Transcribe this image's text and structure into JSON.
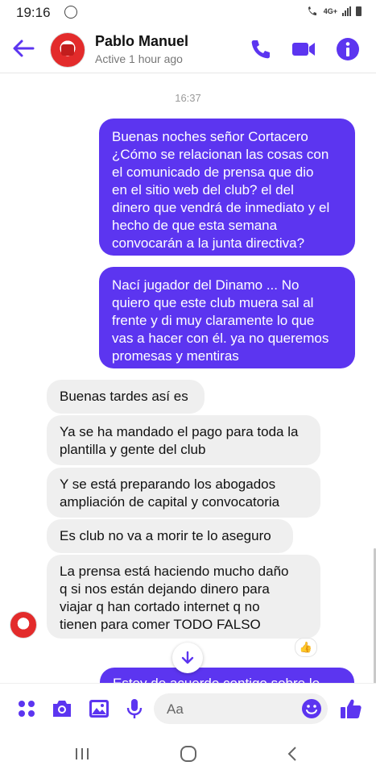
{
  "status_bar": {
    "time": "19:16",
    "network": "4G+"
  },
  "header": {
    "contact_name": "Pablo Manuel",
    "status": "Active 1 hour ago"
  },
  "conversation": {
    "timestamp": "16:37",
    "outgoing": [
      {
        "text": "Buenas noches señor Cortacero\n¿Cómo se relacionan las cosas con\nel comunicado de prensa que dio\nen el sitio web del club? el del\ndinero que vendrá de inmediato y el\nhecho de que esta semana\nconvocarán a la junta directiva?"
      },
      {
        "text": "Nací jugador del Dinamo ... No\nquiero que este club muera sal al\nfrente y di muy claramente lo que\nvas a hacer con él. ya no queremos\npromesas y mentiras"
      }
    ],
    "incoming": [
      {
        "text": "Buenas tardes así es"
      },
      {
        "text": "Ya se ha mandado el pago para toda la\nplantilla y gente del club"
      },
      {
        "text": "Y se está preparando los abogados\nampliación de capital y convocatoria"
      },
      {
        "text": "Es club no va a morir te lo aseguro"
      },
      {
        "text": "La prensa está haciendo mucho daño\nq si nos están dejando dinero para\nviajar q han cortado internet q no\ntienen para comer TODO FALSO"
      }
    ],
    "reaction": "👍",
    "partial_outgoing": "Estoy de acuerdo contigo sobre lo"
  },
  "composer": {
    "placeholder": "Aa"
  },
  "colors": {
    "accent": "#5c35f0",
    "incoming_bg": "#efefef",
    "reaction_yellow": "#f5c33b"
  },
  "icons": [
    "back-arrow-icon",
    "phone-icon",
    "video-icon",
    "info-icon",
    "apps-icon",
    "camera-icon",
    "image-icon",
    "mic-icon",
    "emoji-icon",
    "like-icon",
    "chevron-down-icon"
  ]
}
